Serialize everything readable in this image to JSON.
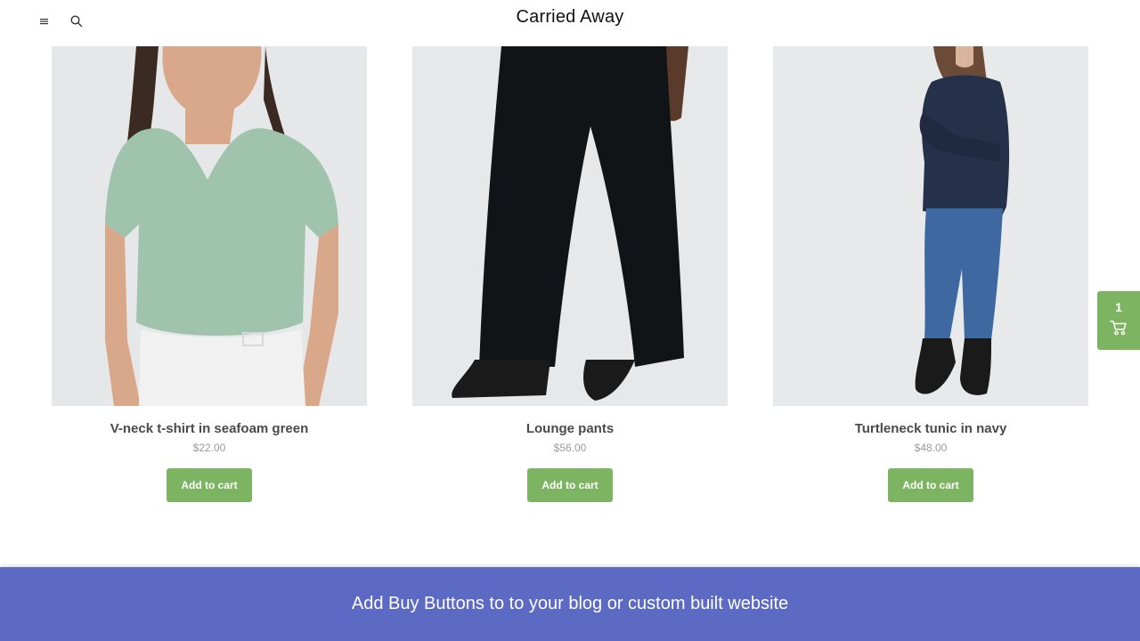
{
  "header": {
    "title": "Carried Away",
    "menu_icon": "hamburger-menu-icon",
    "search_icon": "search-icon"
  },
  "products": [
    {
      "name": "V-neck t-shirt in seafoam green",
      "price": "$22.00",
      "button": "Add to cart"
    },
    {
      "name": "Lounge pants",
      "price": "$56.00",
      "button": "Add to cart"
    },
    {
      "name": "Turtleneck tunic in navy",
      "price": "$48.00",
      "button": "Add to cart"
    }
  ],
  "cart": {
    "count": "1",
    "icon": "shopping-cart-icon"
  },
  "banner": {
    "text": "Add Buy Buttons to to your blog or custom built website"
  },
  "colors": {
    "accent": "#7db461",
    "banner": "#5c6ac4",
    "photo_background": "#e9eaec"
  }
}
